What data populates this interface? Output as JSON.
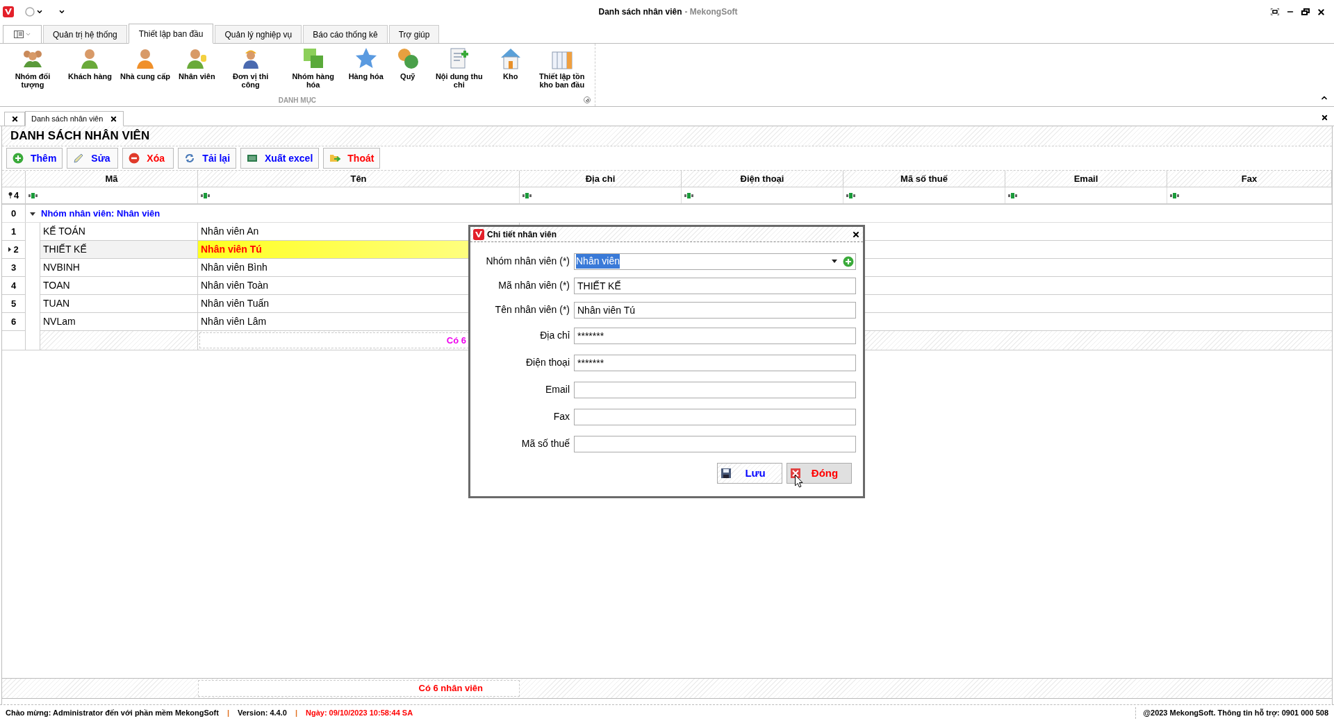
{
  "window": {
    "title": "Danh sách nhân viên",
    "app_name": "- MekongSoft"
  },
  "ribbon_tabs": [
    {
      "label": "Quản trị hệ thống",
      "selected": false
    },
    {
      "label": "Thiết lập ban đầu",
      "selected": true
    },
    {
      "label": "Quản lý nghiệp vụ",
      "selected": false
    },
    {
      "label": "Báo cáo thống kê",
      "selected": false
    },
    {
      "label": "Trợ giúp",
      "selected": false
    }
  ],
  "ribbon_group": {
    "label": "DANH MỤC",
    "items": [
      {
        "kind": "group",
        "label": "Nhóm đối tượng"
      },
      {
        "kind": "person",
        "label": "Khách hàng"
      },
      {
        "kind": "supplier",
        "label": "Nhà cung cấp"
      },
      {
        "kind": "staff",
        "label": "Nhân viên"
      },
      {
        "kind": "worker",
        "label": "Đơn vị thi công"
      },
      {
        "kind": "squares",
        "label": "Nhóm hàng hóa"
      },
      {
        "kind": "star",
        "label": "Hàng hóa"
      },
      {
        "kind": "coins",
        "label": "Quỹ"
      },
      {
        "kind": "document",
        "label": "Nội dung thu chi"
      },
      {
        "kind": "house",
        "label": "Kho"
      },
      {
        "kind": "columns",
        "label": "Thiết lập tồn kho ban đầu"
      }
    ]
  },
  "document_tab": {
    "label": "Danh sách nhân viên"
  },
  "page": {
    "heading": "DANH SÁCH NHÂN VIÊN"
  },
  "toolbar": [
    {
      "kind": "add",
      "label": "Thêm",
      "color": "#0000ff"
    },
    {
      "kind": "edit",
      "label": "Sửa",
      "color": "#0000ff"
    },
    {
      "kind": "delete",
      "label": "Xóa",
      "color": "#ff0000"
    },
    {
      "kind": "reload",
      "label": "Tải lại",
      "color": "#0000ff"
    },
    {
      "kind": "excel",
      "label": "Xuất excel",
      "color": "#0000ff"
    },
    {
      "kind": "exit",
      "label": "Thoát",
      "color": "#ff0000"
    }
  ],
  "grid": {
    "columns": [
      "Mã",
      "Tên",
      "Địa chỉ",
      "Điện thoại",
      "Mã số thuế",
      "Email",
      "Fax"
    ],
    "filter_count": "4",
    "group": {
      "index": "0",
      "label": "Nhóm nhân viên: Nhân viên",
      "expanded": true
    },
    "rows": [
      {
        "index": "1",
        "code": "KẾ TOÁN",
        "name": "Nhân viên An",
        "selected": false
      },
      {
        "index": "2",
        "code": "THIẾT KẾ",
        "name": "Nhân viên Tú",
        "selected": true
      },
      {
        "index": "3",
        "code": "NVBINH",
        "name": "Nhân viên Bình",
        "selected": false
      },
      {
        "index": "4",
        "code": "TOAN",
        "name": "Nhân viên Toàn",
        "selected": false
      },
      {
        "index": "5",
        "code": "TUAN",
        "name": "Nhân viên Tuấn",
        "selected": false
      },
      {
        "index": "6",
        "code": "NVLam",
        "name": "Nhân viên Lâm",
        "selected": false
      }
    ],
    "group_footer": "Có 6",
    "footer": "Có 6 nhân viên"
  },
  "dialog": {
    "title": "Chi tiết nhân viên",
    "fields": [
      {
        "kind": "combo",
        "label": "Nhóm nhân viên (*)",
        "value": "Nhân viên",
        "highlighted": true
      },
      {
        "kind": "text",
        "label": "Mã nhân viên (*)",
        "value": "THIẾT KẾ"
      },
      {
        "kind": "text",
        "label": "Tên nhân viên (*)",
        "value": "Nhân viên Tú"
      },
      {
        "kind": "text",
        "label": "Địa chỉ",
        "value": "*******"
      },
      {
        "kind": "text",
        "label": "Điện thoại",
        "value": "*******"
      },
      {
        "kind": "text",
        "label": "Email"
      },
      {
        "kind": "text",
        "label": "Fax"
      },
      {
        "kind": "text",
        "label": "Mã số thuế"
      }
    ],
    "buttons": [
      {
        "kind": "save",
        "label": "Lưu",
        "color": "#0000ff"
      },
      {
        "kind": "close",
        "label": "Đóng",
        "color": "#ff0000"
      }
    ]
  },
  "status_bar": {
    "left": [
      {
        "text": "Chào mừng: Administrator đến với phần mềm MekongSoft",
        "color": "#000000"
      },
      {
        "text": "|",
        "color": "#e07020"
      },
      {
        "text": "Version: 4.4.0",
        "color": "#000000"
      },
      {
        "text": "|",
        "color": "#e07020"
      },
      {
        "text": "Ngày: 09/10/2023 10:58:44 SA",
        "color": "#ff0000"
      }
    ],
    "right": "@2023 MekongSoft. Thông tin hỗ trợ: 0901 000 508"
  }
}
